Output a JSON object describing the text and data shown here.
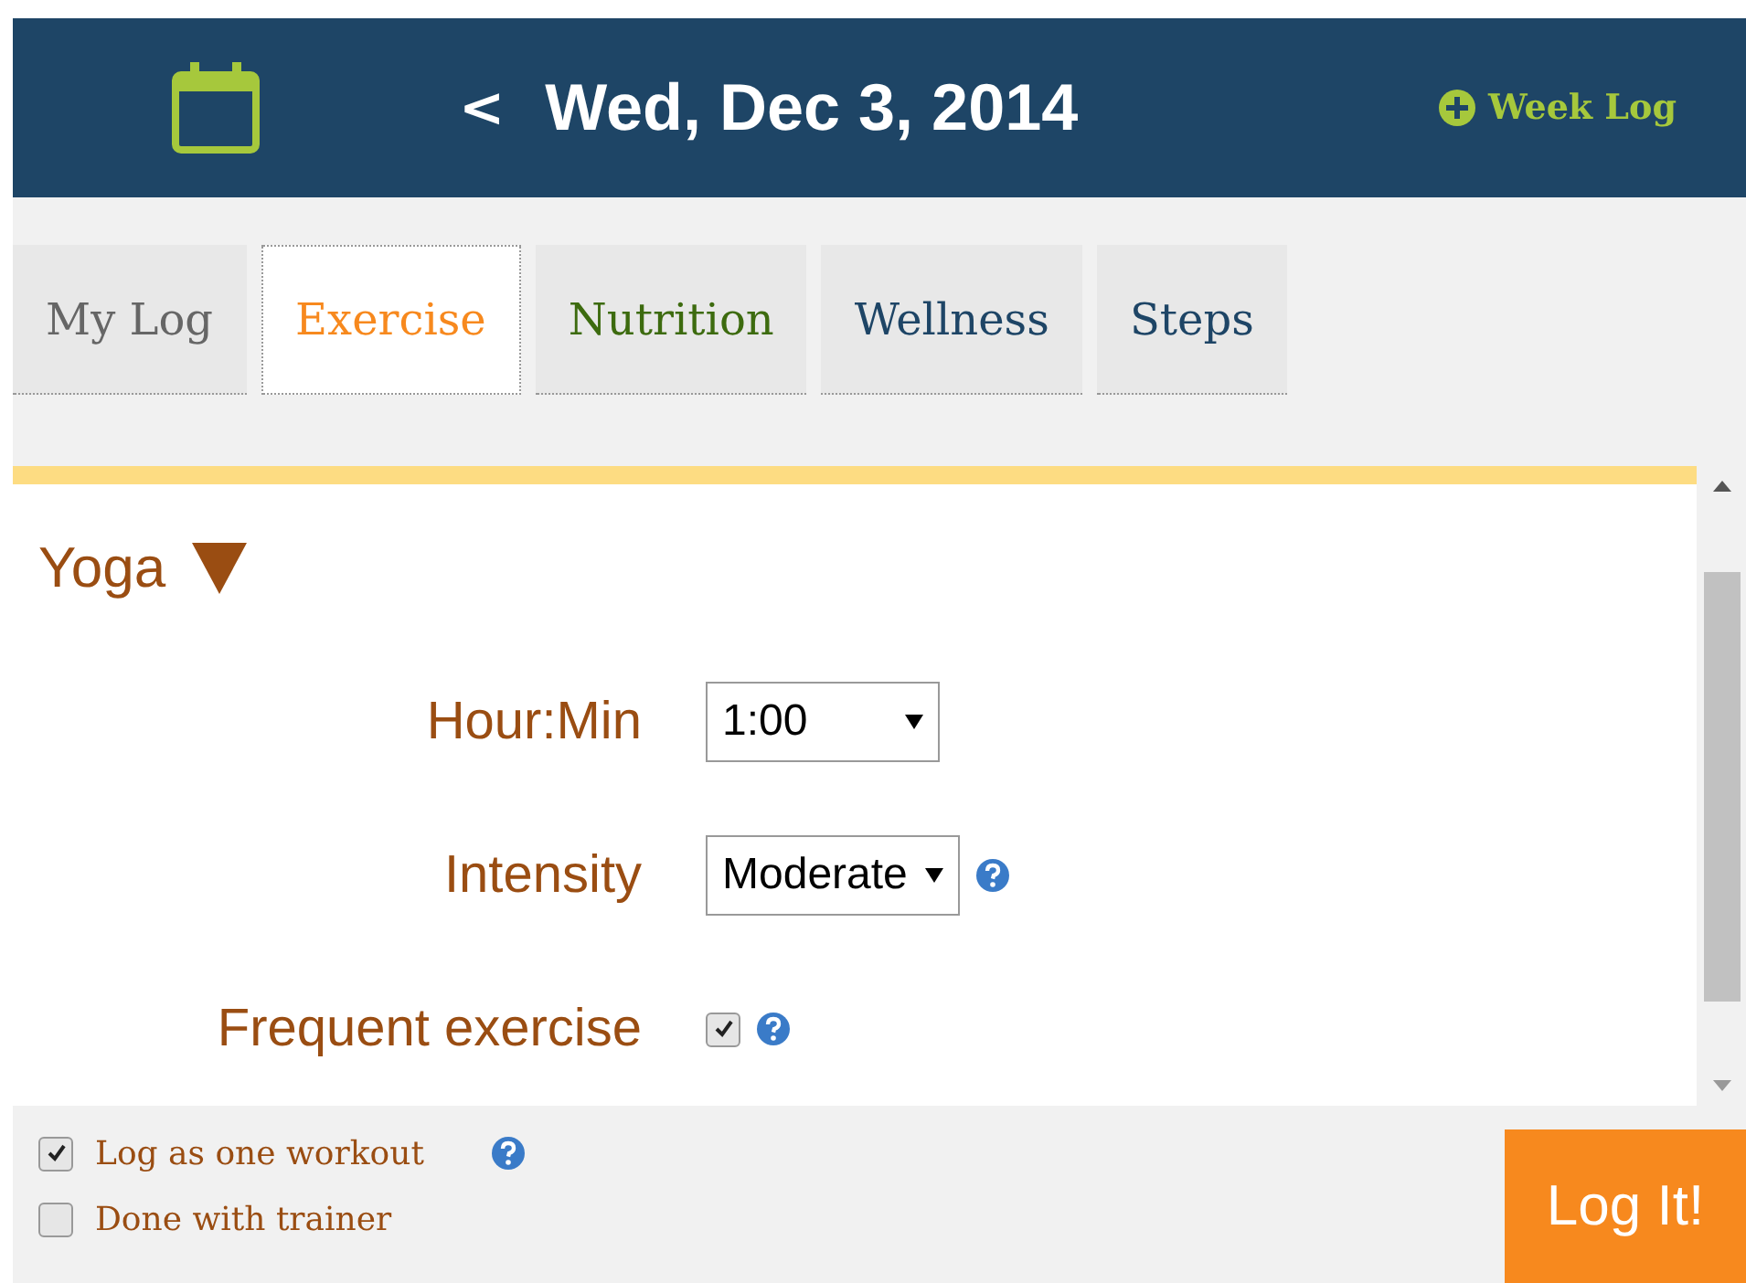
{
  "header": {
    "date": "Wed, Dec 3, 2014",
    "prev": "<",
    "week_log": "Week Log"
  },
  "tabs": [
    {
      "label": "My Log",
      "selected": false,
      "color": "#666666"
    },
    {
      "label": "Exercise",
      "selected": true,
      "color": "#f7891e"
    },
    {
      "label": "Nutrition",
      "selected": false,
      "color": "#3d6b0f"
    },
    {
      "label": "Wellness",
      "selected": false,
      "color": "#1e4566"
    },
    {
      "label": "Steps",
      "selected": false,
      "color": "#1e4566"
    }
  ],
  "activity": {
    "title": "Yoga",
    "expanded": true,
    "fields": [
      {
        "kind": "select",
        "label": "Hour:Min",
        "value": "1:00",
        "help": false
      },
      {
        "kind": "select",
        "label": "Intensity",
        "value": "Moderate",
        "help": true
      },
      {
        "kind": "checkbox",
        "label": "Frequent exercise",
        "checked": true,
        "help": true
      }
    ]
  },
  "options": [
    {
      "label": "Log as one workout",
      "checked": true,
      "help": true
    },
    {
      "label": "Done with trainer",
      "checked": false,
      "help": false
    }
  ],
  "submit": "Log It!"
}
